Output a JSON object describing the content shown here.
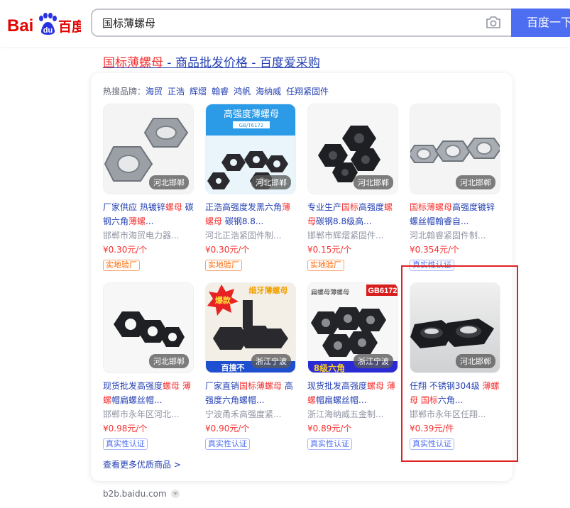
{
  "header": {
    "logo_text_a": "Bai",
    "logo_text_b": "du",
    "logo_text_c": "百度",
    "search_value": "国标薄螺母",
    "search_button": "百度一下",
    "camera": "camera-icon"
  },
  "result": {
    "title_highlight": "国标薄螺母",
    "title_rest": " - 商品批发价格 - 百度爱采购",
    "brands_label": "热搜品牌：",
    "brands": [
      "海贸",
      "正浩",
      "辉熠",
      "翰睿",
      "鸿帆",
      "海纳威",
      "任翔紧固件"
    ],
    "items": [
      {
        "location": "河北邯郸",
        "desc": [
          {
            "t": "厂家供应 热镀锌",
            "h": false
          },
          {
            "t": "螺母",
            "h": true
          },
          {
            "t": " 碳钢六角",
            "h": false
          },
          {
            "t": "薄螺",
            "h": true
          },
          {
            "t": "...",
            "h": false
          }
        ],
        "seller": "邯郸市海贸电力器...",
        "price": "¥0.30元/个",
        "tag": "实地验厂",
        "tag_type": "orange"
      },
      {
        "location": "河北邯郸",
        "desc": [
          {
            "t": "正浩高强度发黑六角",
            "h": false
          },
          {
            "t": "薄螺母",
            "h": true
          },
          {
            "t": " 碳钢8.8...",
            "h": false
          }
        ],
        "seller": "河北正浩紧固件制...",
        "price": "¥0.30元/个",
        "tag": "实地验厂",
        "tag_type": "orange",
        "img_text": "高强度薄螺母",
        "img_sub": "GB/T6172"
      },
      {
        "location": "河北邯郸",
        "desc": [
          {
            "t": "专业生产",
            "h": false
          },
          {
            "t": "国标",
            "h": true
          },
          {
            "t": "高强度",
            "h": false
          },
          {
            "t": "螺母",
            "h": true
          },
          {
            "t": "碳钢8.8级高...",
            "h": false
          }
        ],
        "seller": "邯郸市辉熠紧固件...",
        "price": "¥0.15元/个",
        "tag": "实地验厂",
        "tag_type": "orange"
      },
      {
        "location": "河北邯郸",
        "desc": [
          {
            "t": "国标薄螺母",
            "h": true
          },
          {
            "t": "高强度镀锌螺丝帽翰睿自...",
            "h": false
          }
        ],
        "seller": "河北翰睿紧固件制...",
        "price": "¥0.354元/个",
        "tag": "真实性认证",
        "tag_type": "blue"
      },
      {
        "location": "河北邯郸",
        "desc": [
          {
            "t": "现货批发高强度",
            "h": false
          },
          {
            "t": "螺母",
            "h": true
          },
          {
            "t": " ",
            "h": false
          },
          {
            "t": "薄螺",
            "h": true
          },
          {
            "t": "帽扁螺丝帽...",
            "h": false
          }
        ],
        "seller": "邯郸市永年区河北...",
        "price": "¥0.98元/个",
        "tag": "真实性认证",
        "tag_type": "blue"
      },
      {
        "location": "浙江宁波",
        "desc": [
          {
            "t": "厂家直销",
            "h": false
          },
          {
            "t": "国标薄螺母",
            "h": true
          },
          {
            "t": " 高强度六角螺帽...",
            "h": false
          }
        ],
        "seller": "宁波甬禾高强度紧...",
        "price": "¥0.90元/个",
        "tag": "真实性认证",
        "tag_type": "blue",
        "img_text": "细牙薄螺母",
        "img_burst": "爆款",
        "img_bottom": "百搜不"
      },
      {
        "location": "浙江宁波",
        "desc": [
          {
            "t": "现货批发高强度",
            "h": false
          },
          {
            "t": "螺母",
            "h": true
          },
          {
            "t": " ",
            "h": false
          },
          {
            "t": "薄螺",
            "h": true
          },
          {
            "t": "帽扁螺丝帽...",
            "h": false
          }
        ],
        "seller": "浙江海纳威五金制...",
        "price": "¥0.89元/个",
        "tag": "真实性认证",
        "tag_type": "blue",
        "img_text": "扁螺母薄螺母",
        "img_badge": "GB6172",
        "img_bottom": "8级六角"
      },
      {
        "location": "河北邯郸",
        "desc": [
          {
            "t": "任翔 不锈钢304级 ",
            "h": false
          },
          {
            "t": "薄螺母",
            "h": true
          },
          {
            "t": " ",
            "h": false
          },
          {
            "t": "国标",
            "h": true
          },
          {
            "t": "六角...",
            "h": false
          }
        ],
        "seller": "邯郸市永年区任翔...",
        "price": "¥0.39元/件",
        "tag": "真实性认证",
        "tag_type": "blue"
      }
    ],
    "more_link": "查看更多优质商品 >",
    "source": "b2b.baidu.com"
  },
  "colors": {
    "brand_blue": "#4e6ef2",
    "link_blue": "#2440b3",
    "highlight_red": "#f73131",
    "annotation_red": "#e02020"
  }
}
